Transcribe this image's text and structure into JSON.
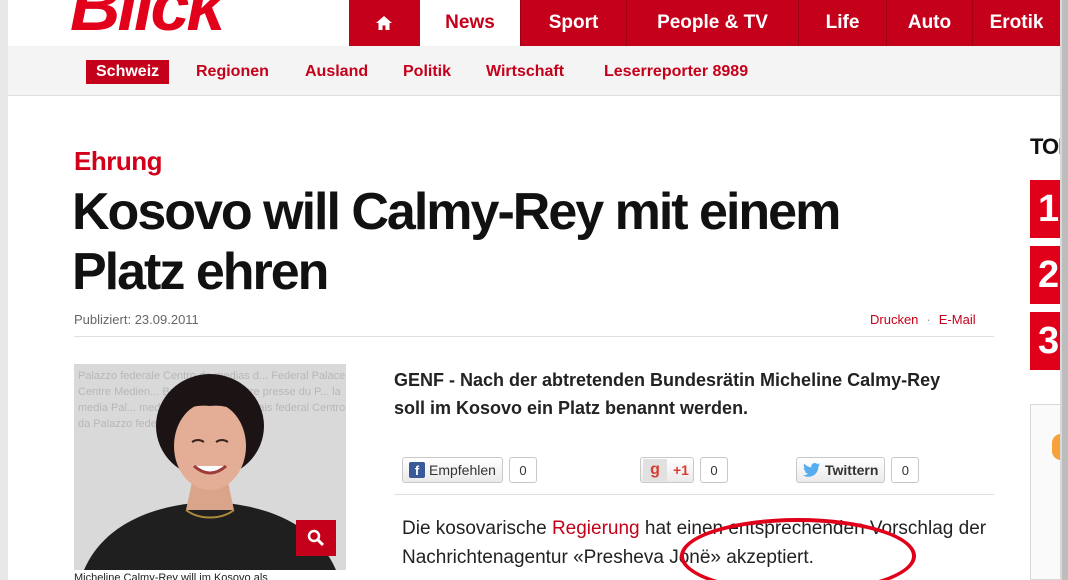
{
  "header": {
    "logo_text": "Blick",
    "nav_items": [
      {
        "label": "News",
        "active": true
      },
      {
        "label": "Sport"
      },
      {
        "label": "People & TV"
      },
      {
        "label": "Life"
      },
      {
        "label": "Auto"
      },
      {
        "label": "Erotik"
      }
    ],
    "home_icon": "home-icon"
  },
  "subnav": {
    "items": [
      {
        "label": "Schweiz",
        "active": true
      },
      {
        "label": "Regionen"
      },
      {
        "label": "Ausland"
      },
      {
        "label": "Politik"
      },
      {
        "label": "Wirtschaft"
      },
      {
        "label": "Leserreporter 8989"
      }
    ]
  },
  "article": {
    "rubric": "Ehrung",
    "headline": "Kosovo will Calmy-Rey mit einem Platz ehren",
    "published": "Publiziert: 23.09.2011",
    "actions": {
      "print": "Drucken",
      "email": "E-Mail"
    },
    "lead": "GENF - Nach der abtretenden Bundesrätin Micheline Calmy-Rey soll im Kosovo ein Platz benannt werden.",
    "photo_background_text": "Palazzo federale Centro da medias d... Federal Palace Centre Medien... Bundeshaus Centre presse du P... la media Pal... media Palais Fede... Palais federal Centro da Palazzo federal...",
    "photo_caption": "Micheline Calmy-Rey will im Kosovo als",
    "body": {
      "text_before_link": "Die kosovarische ",
      "link": "Regierung",
      "text_after_link": " hat einen entsprechenden Vorschlag der Nachrichtenagentur «Presheva Jonë» akzeptiert."
    }
  },
  "social": {
    "facebook": {
      "label": "Empfehlen",
      "count": "0"
    },
    "google": {
      "label": "+1",
      "count": "0"
    },
    "twitter": {
      "label": "Twittern",
      "count": "0"
    }
  },
  "sidebar": {
    "top_label": "TOP",
    "ranks": [
      "1",
      "2",
      "3"
    ]
  },
  "colors": {
    "brand_red": "#c4001a",
    "accent_red": "#e0001a",
    "facebook_blue": "#3b5998",
    "twitter_blue": "#55acee"
  }
}
